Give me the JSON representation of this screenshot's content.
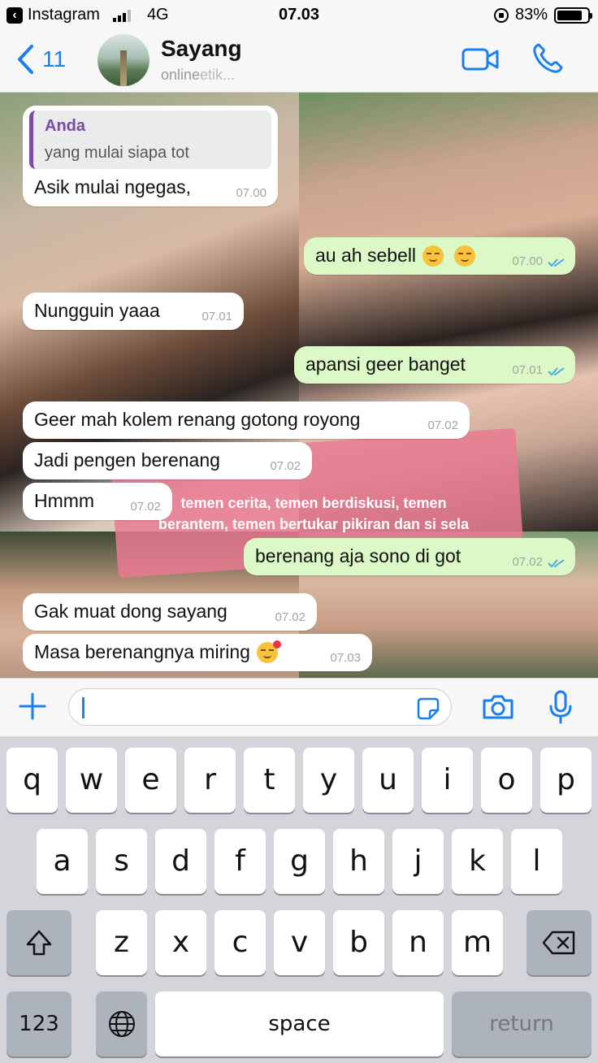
{
  "status_bar": {
    "back_app": "Instagram",
    "network": "4G",
    "time": "07.03",
    "battery": "83%",
    "battery_level": 0.83
  },
  "header": {
    "back_count": "11",
    "contact_name": "Sayang",
    "contact_status": "online",
    "contact_status_typing": "etik..."
  },
  "overlay_text": "temen cerita, temen berdiskusi, temen berantem, temen bertukar pikiran dan si sela",
  "messages": [
    {
      "quote_author": "Anda",
      "quote_text": "yang mulai siapa tot",
      "text": "Asik mulai ngegas,",
      "time": "07.00",
      "dir": "in"
    },
    {
      "text": "au ah sebell",
      "time": "07.00",
      "dir": "out",
      "emoji": [
        "smirk-emoji",
        "smirk-emoji"
      ]
    },
    {
      "text": "Nungguin yaaa",
      "time": "07.01",
      "dir": "in"
    },
    {
      "text": "apansi geer banget",
      "time": "07.01",
      "dir": "out"
    },
    {
      "text": "Geer mah kolem renang gotong royong",
      "time": "07.02",
      "dir": "in"
    },
    {
      "text": "Jadi pengen berenang",
      "time": "07.02",
      "dir": "in"
    },
    {
      "text": "Hmmm",
      "time": "07.02",
      "dir": "in"
    },
    {
      "text": "berenang aja sono di got",
      "time": "07.02",
      "dir": "out"
    },
    {
      "text": "Gak muat dong sayang",
      "time": "07.02",
      "dir": "in"
    },
    {
      "text": "Masa berenangnya miring",
      "time": "07.03",
      "dir": "in",
      "emoji": [
        "kiss-emoji"
      ]
    }
  ],
  "input": {
    "placeholder": "",
    "value": ""
  },
  "keyboard": {
    "row1": [
      "q",
      "w",
      "e",
      "r",
      "t",
      "y",
      "u",
      "i",
      "o",
      "p"
    ],
    "row2": [
      "a",
      "s",
      "d",
      "f",
      "g",
      "h",
      "j",
      "k",
      "l"
    ],
    "row3": [
      "z",
      "x",
      "c",
      "v",
      "b",
      "n",
      "m"
    ],
    "numbers_label": "123",
    "space_label": "space",
    "return_label": "return"
  },
  "colors": {
    "accent": "#1a7ff0",
    "outgoing_bubble": "#dcf8c6",
    "incoming_bubble": "#ffffff",
    "quote_author": "#7a4aa8",
    "read_ticks": "#4fa6e8"
  }
}
